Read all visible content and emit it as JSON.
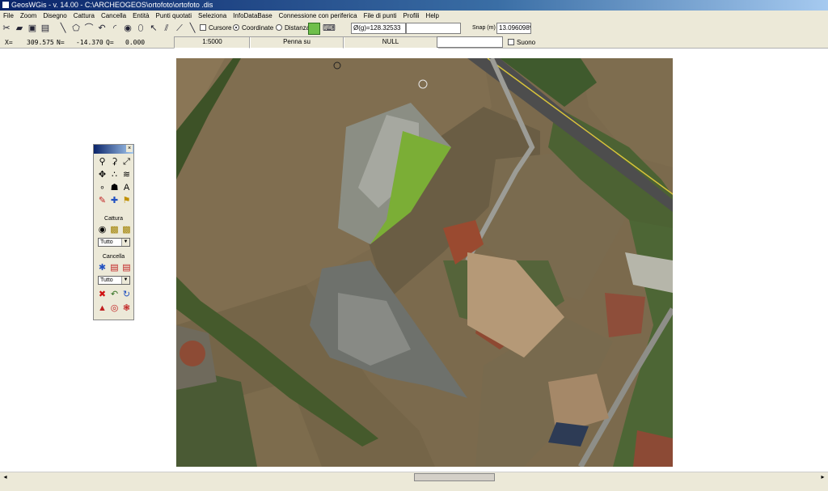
{
  "window": {
    "title": "GeosWGis - v. 14.00 - C:\\ARCHEOGEOS\\ortofoto\\ortofoto .dis"
  },
  "menu": [
    "File",
    "Zoom",
    "Disegno",
    "Cattura",
    "Cancella",
    "Entità",
    "Punti quotati",
    "Seleziona",
    "InfoDataBase",
    "Connessione con periferica",
    "File di punti",
    "Profili",
    "Help"
  ],
  "toolbar": {
    "cursore_label": "Cursore",
    "coordinate_label": "Coordinate",
    "distanza_label": "Distanza",
    "angle_value": "Ø(g)=128.32533",
    "snap_label": "Snap (m)",
    "snap_value": "13.0960989..."
  },
  "status": {
    "x_label": "X=",
    "x_value": "309.575",
    "n_label": "N=",
    "n_value": "-14.370",
    "q_label": "Q=",
    "q_value": "0.000",
    "scale": "1:5000",
    "pen": "Penna su",
    "null_text": "NULL",
    "suono_label": "Suono"
  },
  "palette": {
    "cattura_label": "Cattura",
    "cattura_select": "Tutto",
    "cancella_label": "Cancella",
    "cancella_select": "Tutto"
  },
  "colors": {
    "titlebar": "#0a246a",
    "chrome": "#ece9d8",
    "field_bg": "#7b6a4d",
    "road": "#4d4d4d",
    "roof": "#9a4a30"
  }
}
